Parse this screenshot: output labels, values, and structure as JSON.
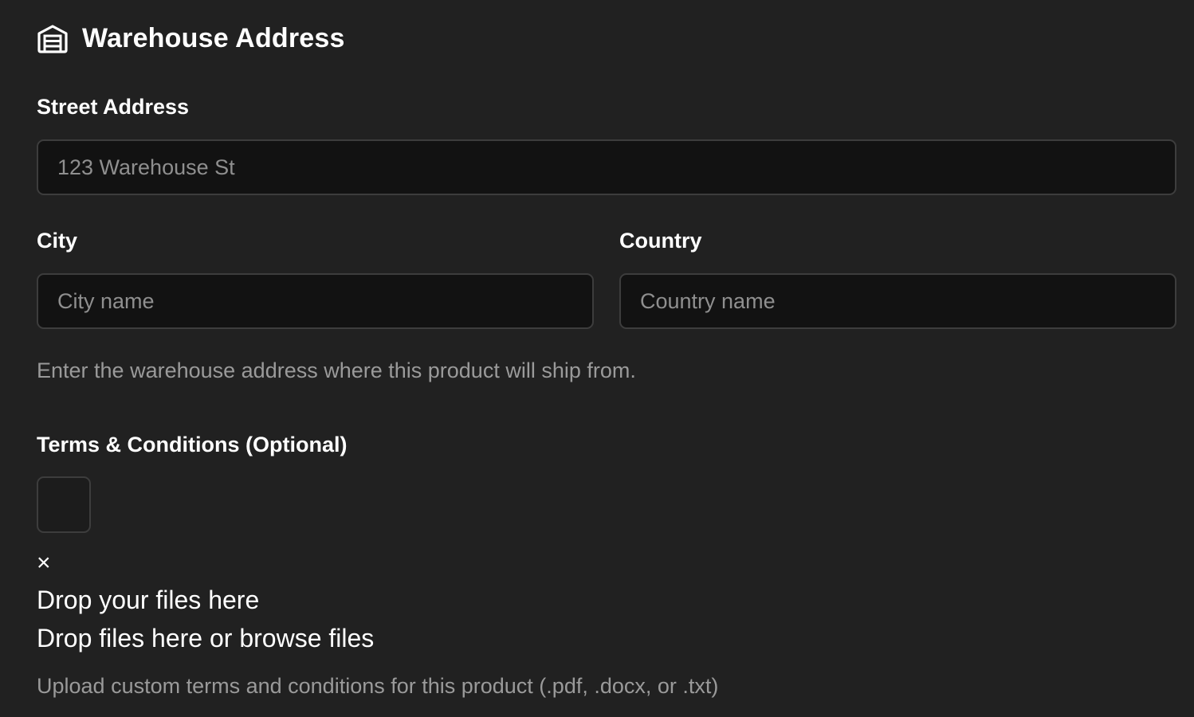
{
  "header": {
    "title": "Warehouse Address",
    "icon": "warehouse-icon"
  },
  "street": {
    "label": "Street Address",
    "placeholder": "123 Warehouse St",
    "value": ""
  },
  "city": {
    "label": "City",
    "placeholder": "City name",
    "value": ""
  },
  "country": {
    "label": "Country",
    "placeholder": "Country name",
    "value": ""
  },
  "address_help": "Enter the warehouse address where this product will ship from.",
  "terms": {
    "label": "Terms & Conditions (Optional)",
    "remove_symbol": "×",
    "drop_title": "Drop your files here",
    "drop_subtitle": "Drop files here or browse files",
    "help": "Upload custom terms and conditions for this product (.pdf, .docx, or .txt)"
  },
  "colors": {
    "background": "#212121",
    "input_background": "#121212",
    "border": "#3d3d3d",
    "muted_text": "#9a9a9a"
  }
}
